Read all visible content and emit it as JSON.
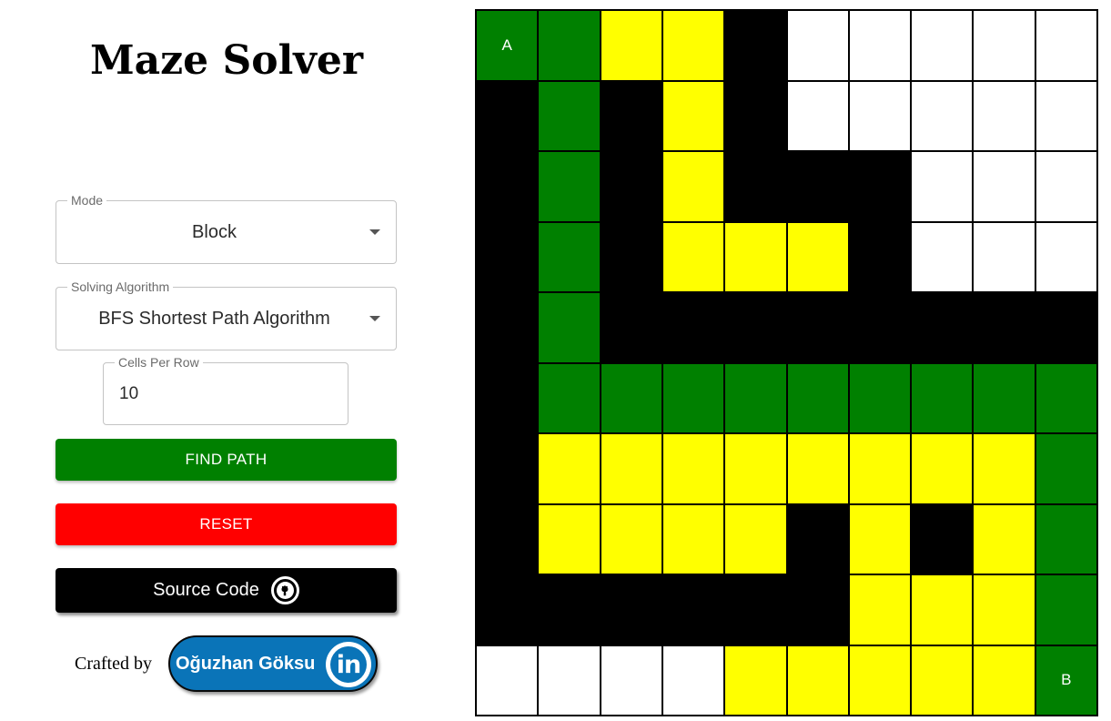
{
  "app": {
    "title": "Maze Solver"
  },
  "controls": {
    "mode": {
      "label": "Mode",
      "value": "Block"
    },
    "algorithm": {
      "label": "Solving Algorithm",
      "value": "BFS Shortest Path Algorithm"
    },
    "cells_per_row": {
      "label": "Cells Per Row",
      "value": "10"
    },
    "find_path_label": "FIND PATH",
    "reset_label": "RESET",
    "source_code_label": "Source Code"
  },
  "footer": {
    "crafted_by": "Crafted by",
    "author": "Oğuzhan Göksu",
    "linkedin_text": "in"
  },
  "colors": {
    "wall": "#000000",
    "path": "#008000",
    "visited": "#ffff00",
    "empty": "#ffffff",
    "find_button": "#008000",
    "reset_button": "#ff0000",
    "linkedin": "#0a74b8"
  },
  "maze": {
    "legend": {
      "W": "wall",
      "G": "path",
      "Y": "visited",
      "E": "empty"
    },
    "start_label": "A",
    "end_label": "B",
    "rows": [
      [
        "G",
        "G",
        "Y",
        "Y",
        "W",
        "E",
        "E",
        "E",
        "E",
        "E"
      ],
      [
        "W",
        "G",
        "W",
        "Y",
        "W",
        "E",
        "E",
        "E",
        "E",
        "E"
      ],
      [
        "W",
        "G",
        "W",
        "Y",
        "W",
        "W",
        "W",
        "E",
        "E",
        "E"
      ],
      [
        "W",
        "G",
        "W",
        "Y",
        "Y",
        "Y",
        "W",
        "E",
        "E",
        "E"
      ],
      [
        "W",
        "G",
        "W",
        "W",
        "W",
        "W",
        "W",
        "W",
        "W",
        "W"
      ],
      [
        "W",
        "G",
        "G",
        "G",
        "G",
        "G",
        "G",
        "G",
        "G",
        "G"
      ],
      [
        "W",
        "Y",
        "Y",
        "Y",
        "Y",
        "Y",
        "Y",
        "Y",
        "Y",
        "G"
      ],
      [
        "W",
        "Y",
        "Y",
        "Y",
        "Y",
        "W",
        "Y",
        "W",
        "Y",
        "G"
      ],
      [
        "W",
        "W",
        "W",
        "W",
        "W",
        "W",
        "Y",
        "Y",
        "Y",
        "G"
      ],
      [
        "E",
        "E",
        "E",
        "E",
        "Y",
        "Y",
        "Y",
        "Y",
        "Y",
        "G"
      ]
    ],
    "start": [
      0,
      0
    ],
    "end": [
      9,
      9
    ]
  }
}
